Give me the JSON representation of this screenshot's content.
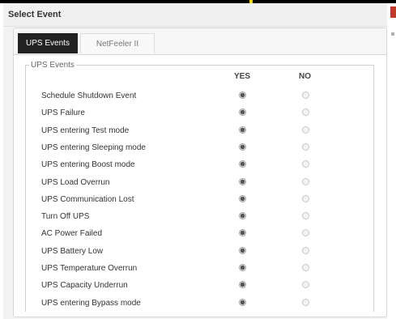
{
  "dialog": {
    "title": "Select Event"
  },
  "tabs": [
    {
      "label": "UPS Events",
      "active": true
    },
    {
      "label": "NetFeeler II",
      "active": false
    }
  ],
  "group": {
    "legend": "UPS Events",
    "columns": {
      "yes": "YES",
      "no": "NO"
    },
    "events": [
      {
        "label": "Schedule Shutdown Event",
        "selected": "yes"
      },
      {
        "label": "UPS Failure",
        "selected": "yes"
      },
      {
        "label": "UPS entering Test mode",
        "selected": "yes"
      },
      {
        "label": "UPS entering Sleeping mode",
        "selected": "yes"
      },
      {
        "label": "UPS entering Boost mode",
        "selected": "yes"
      },
      {
        "label": "UPS Load Overrun",
        "selected": "yes"
      },
      {
        "label": "UPS Communication Lost",
        "selected": "yes"
      },
      {
        "label": "Turn Off UPS",
        "selected": "yes"
      },
      {
        "label": "AC Power Failed",
        "selected": "yes"
      },
      {
        "label": "UPS Battery Low",
        "selected": "yes"
      },
      {
        "label": "UPS Temperature Overrun",
        "selected": "yes"
      },
      {
        "label": "UPS Capacity Underrun",
        "selected": "yes"
      },
      {
        "label": "UPS entering Bypass mode",
        "selected": "yes"
      }
    ]
  },
  "colors": {
    "active_tab": "#222222",
    "header_bg": "#f0f0f0",
    "close_marker": "#c0392b",
    "top_accent": "#f5d800"
  }
}
